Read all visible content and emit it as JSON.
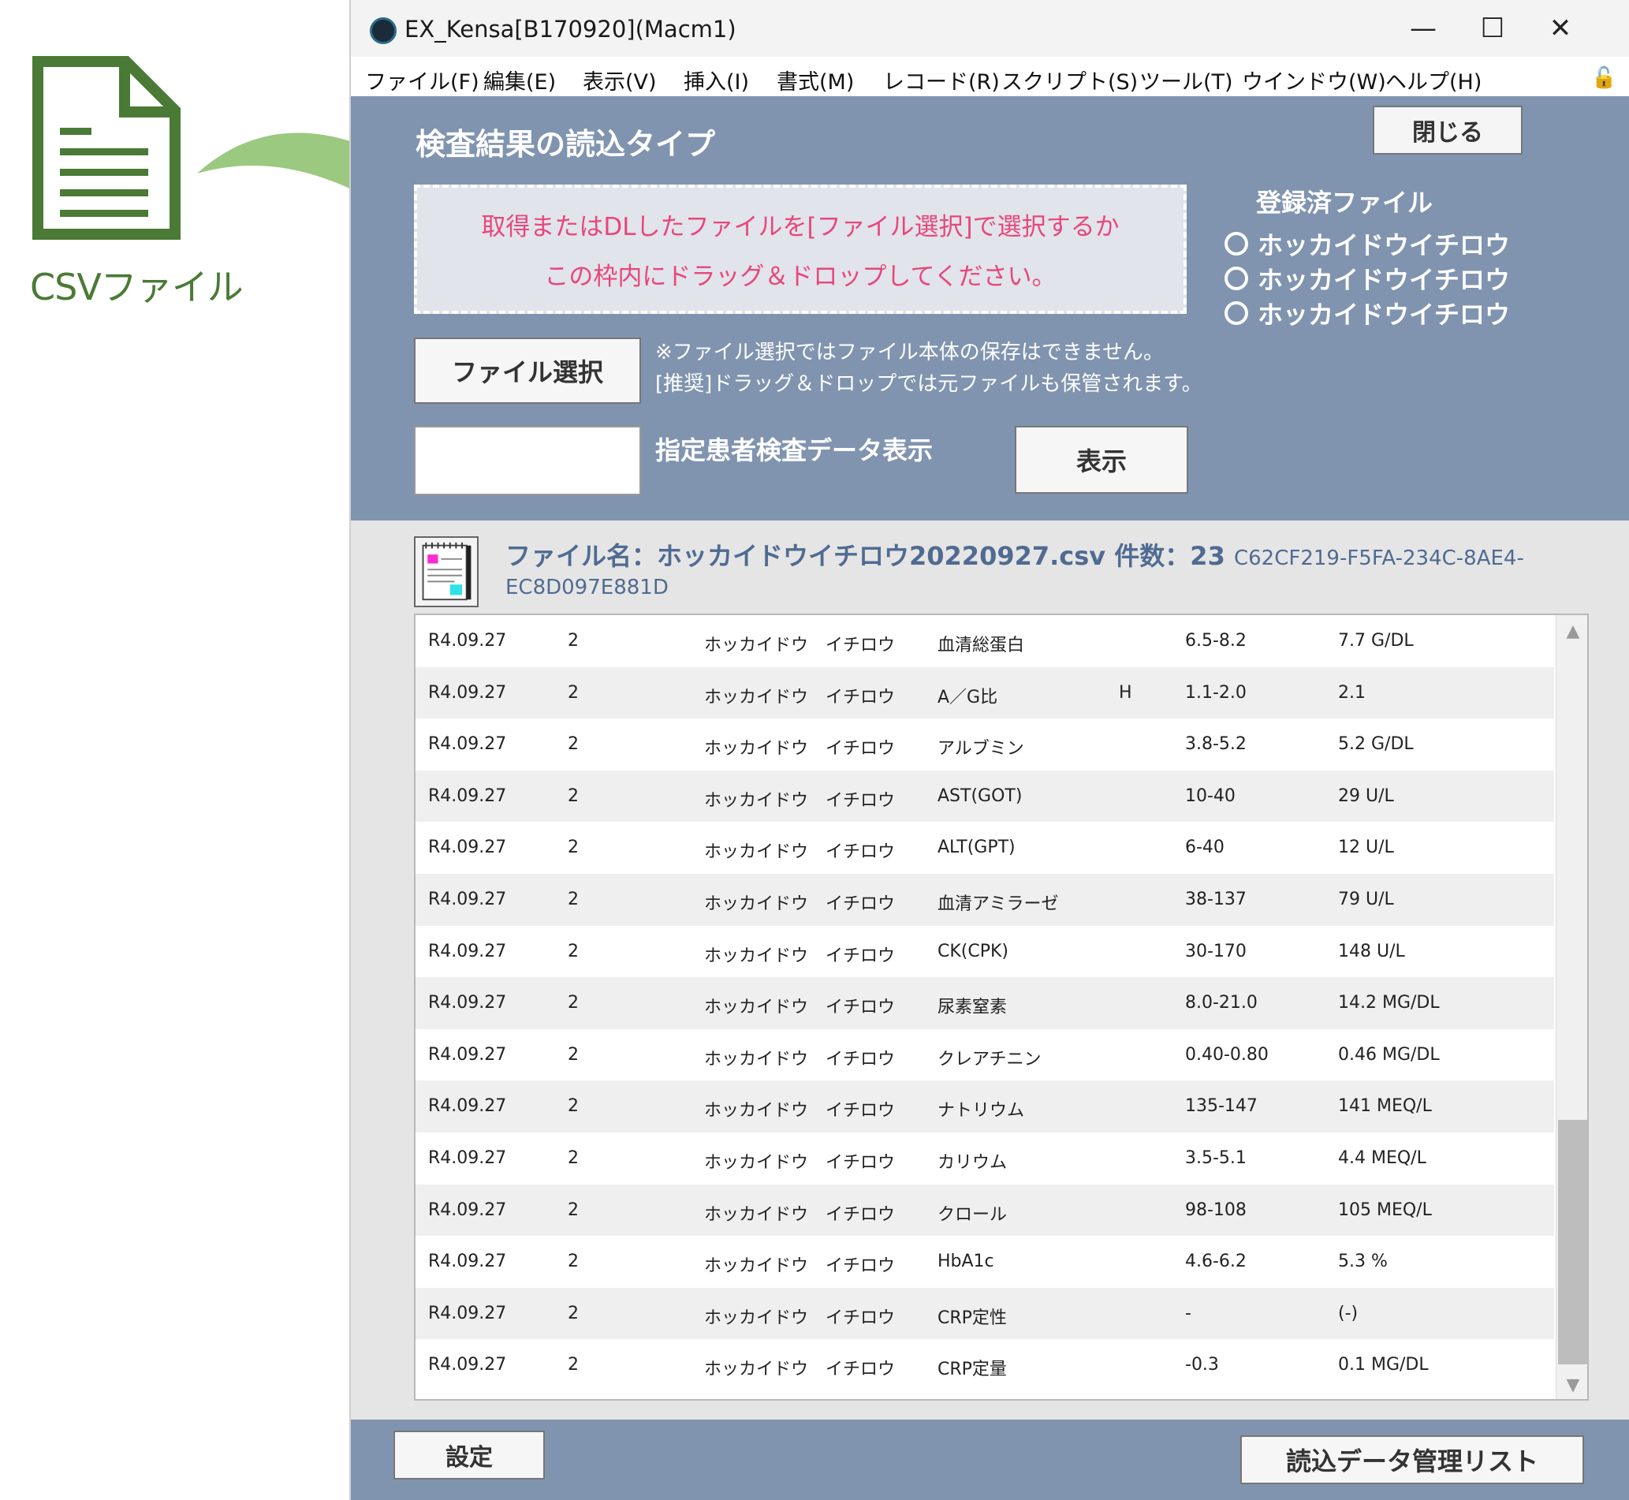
{
  "annotation": {
    "csv_label": "CSVファイル",
    "doc_icon": "document-icon",
    "arrow_icon": "curved-arrow-icon"
  },
  "window": {
    "title": "EX_Kensa[B170920](Macm1)",
    "controls": {
      "minimize": "—",
      "maximize": "☐",
      "close": "✕"
    },
    "menu": [
      "ファイル(F)",
      "編集(E)",
      "表示(V)",
      "挿入(I)",
      "書式(M)",
      "レコード(R)",
      "スクリプト(S)",
      "ツール(T)",
      "ウインドウ(W)",
      "ヘルプ(H)"
    ],
    "lock_icon": "🔓"
  },
  "panel": {
    "heading": "検査結果の読込タイプ",
    "close_button": "閉じる",
    "drop_zone": {
      "line1": "取得またはDLしたファイルを[ファイル選択]で選択するか",
      "line2": "この枠内にドラッグ＆ドロップしてください。"
    },
    "registered": {
      "heading": "登録済ファイル",
      "options": [
        "ホッカイドウイチロウ",
        "ホッカイドウイチロウ",
        "ホッカイドウイチロウ"
      ]
    },
    "file_select_button": "ファイル選択",
    "notes": [
      "※ファイル選択ではファイル本体の保存はできません。",
      "[推奨]ドラッグ＆ドロップでは元ファイルも保管されます。"
    ],
    "patient_input_value": "",
    "patient_label": "指定患者検査データ表示",
    "show_button": "表示"
  },
  "file_info": {
    "name_label": "ファイル名：ホッカイドウイチロウ20220927.csv 件数：23",
    "uuid_part1": "C62CF219-F5FA-234C-8AE4-",
    "uuid_part2": "EC8D097E881D"
  },
  "table": {
    "rows": [
      [
        "R4.09.27",
        "2",
        "ホッカイドウ　イチロウ",
        "血清総蛋白",
        "",
        "6.5-8.2",
        "7.7 G/DL"
      ],
      [
        "R4.09.27",
        "2",
        "ホッカイドウ　イチロウ",
        "A／G比",
        "H",
        "1.1-2.0",
        "2.1"
      ],
      [
        "R4.09.27",
        "2",
        "ホッカイドウ　イチロウ",
        "アルブミン",
        "",
        "3.8-5.2",
        "5.2 G/DL"
      ],
      [
        "R4.09.27",
        "2",
        "ホッカイドウ　イチロウ",
        "AST(GOT)",
        "",
        "10-40",
        "29 U/L"
      ],
      [
        "R4.09.27",
        "2",
        "ホッカイドウ　イチロウ",
        "ALT(GPT)",
        "",
        "6-40",
        "12 U/L"
      ],
      [
        "R4.09.27",
        "2",
        "ホッカイドウ　イチロウ",
        "血清アミラーゼ",
        "",
        "38-137",
        "79 U/L"
      ],
      [
        "R4.09.27",
        "2",
        "ホッカイドウ　イチロウ",
        "CK(CPK)",
        "",
        "30-170",
        "148 U/L"
      ],
      [
        "R4.09.27",
        "2",
        "ホッカイドウ　イチロウ",
        "尿素窒素",
        "",
        "8.0-21.0",
        "14.2 MG/DL"
      ],
      [
        "R4.09.27",
        "2",
        "ホッカイドウ　イチロウ",
        "クレアチニン",
        "",
        "0.40-0.80",
        "0.46 MG/DL"
      ],
      [
        "R4.09.27",
        "2",
        "ホッカイドウ　イチロウ",
        "ナトリウム",
        "",
        "135-147",
        "141 MEQ/L"
      ],
      [
        "R4.09.27",
        "2",
        "ホッカイドウ　イチロウ",
        "カリウム",
        "",
        "3.5-5.1",
        "4.4 MEQ/L"
      ],
      [
        "R4.09.27",
        "2",
        "ホッカイドウ　イチロウ",
        "クロール",
        "",
        "98-108",
        "105 MEQ/L"
      ],
      [
        "R4.09.27",
        "2",
        "ホッカイドウ　イチロウ",
        "HbA1c",
        "",
        "4.6-6.2",
        "5.3 %"
      ],
      [
        "R4.09.27",
        "2",
        "ホッカイドウ　イチロウ",
        "CRP定性",
        "",
        "-",
        "(-)"
      ],
      [
        "R4.09.27",
        "2",
        "ホッカイドウ　イチロウ",
        "CRP定量",
        "",
        "-0.3",
        "0.1 MG/DL"
      ]
    ],
    "scroll_up": "▲",
    "scroll_down": "▼"
  },
  "bottom": {
    "settings_button": "設定",
    "import_list_button": "読込データ管理リスト"
  },
  "colors": {
    "panel_bg": "#8094b0",
    "drop_text": "#e8467d",
    "file_info_text": "#4f6b92",
    "csv_green": "#4a7a35",
    "arrow_green": "#9bc97f"
  }
}
